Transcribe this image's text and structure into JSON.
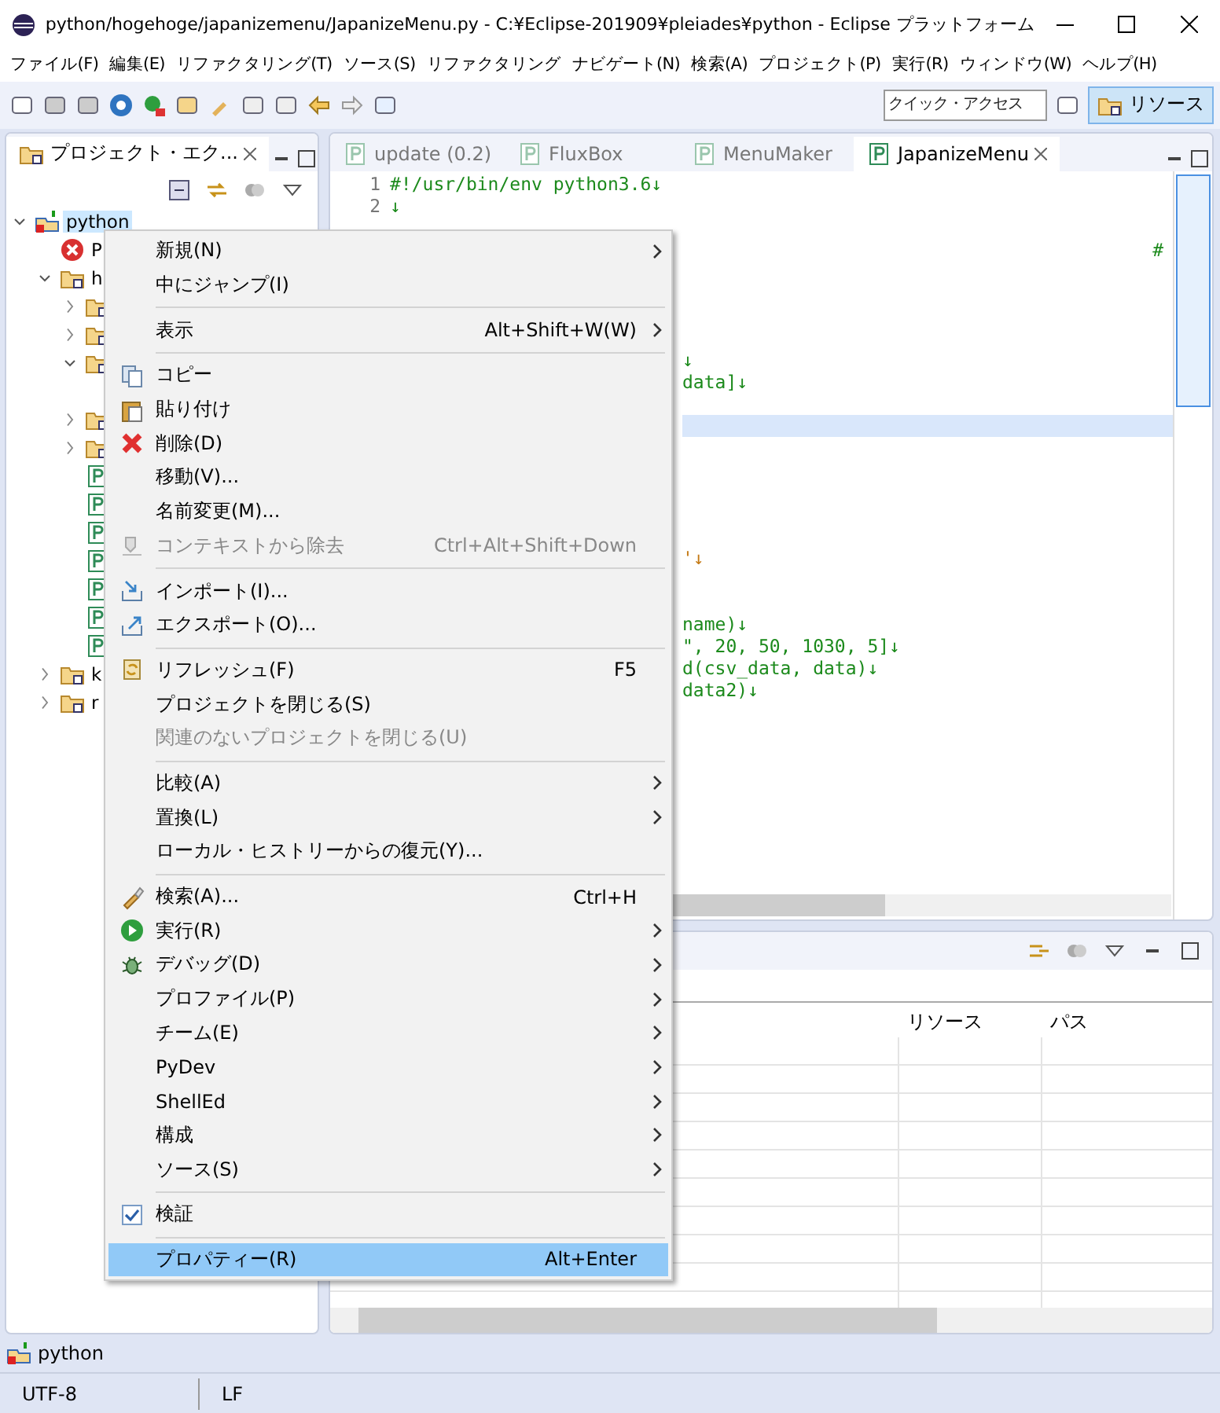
{
  "window": {
    "title": "python/hogehoge/japanizemenu/JapanizeMenu.py - C:¥Eclipse-201909¥pleiades¥python - Eclipse プラットフォーム"
  },
  "menubar": [
    "ファイル(F)",
    "編集(E)",
    "リファクタリング(T)",
    "ソース(S)",
    "リファクタリング",
    "ナビゲート(N)",
    "検索(A)",
    "プロジェクト(P)",
    "実行(R)",
    "ウィンドウ(W)",
    "ヘルプ(H)"
  ],
  "toolbar": {
    "quick_access": {
      "placeholder": "クイック・アクセス"
    },
    "perspectives": [
      {
        "label": "リソース",
        "selected": true
      }
    ]
  },
  "explorer": {
    "tab": "プロジェクト・エク...",
    "tree": [
      {
        "label": "python",
        "kind": "project",
        "selected": true,
        "expanded": true,
        "children": [
          {
            "label": "P",
            "kind": "error",
            "selected": false
          },
          {
            "label": "h",
            "kind": "folder",
            "selected": false,
            "expanded": true,
            "children": [
              {
                "kind": "folder",
                "selected": false,
                "expanded": false
              },
              {
                "kind": "folder",
                "selected": false,
                "expanded": false
              },
              {
                "kind": "folder",
                "selected": false,
                "expanded": true
              },
              {
                "kind": "folder",
                "selected": false,
                "expanded": false
              },
              {
                "kind": "folder",
                "selected": false,
                "expanded": false
              },
              {
                "kind": "file",
                "selected": false
              },
              {
                "kind": "file",
                "selected": false
              },
              {
                "kind": "file",
                "selected": false
              },
              {
                "kind": "file",
                "selected": false
              },
              {
                "kind": "file",
                "selected": false
              },
              {
                "kind": "file",
                "selected": false
              },
              {
                "kind": "file",
                "selected": false
              }
            ]
          },
          {
            "label": "k",
            "kind": "folder",
            "selected": false,
            "expanded": false
          },
          {
            "label": "r",
            "kind": "folder",
            "selected": false,
            "expanded": false
          }
        ]
      }
    ]
  },
  "editor": {
    "tabs": [
      {
        "label": "update (0.2)",
        "selected": false
      },
      {
        "label": "FluxBox",
        "selected": false
      },
      {
        "label": "MenuMaker",
        "selected": false
      },
      {
        "label": "JapanizeMenu",
        "selected": true
      }
    ],
    "lines": [
      {
        "number": "1",
        "text": "#!/usr/bin/env python3.6↓",
        "kind": "code",
        "current": false
      },
      {
        "number": "2",
        "text": "↓",
        "kind": "code",
        "current": false
      },
      {
        "current": false
      },
      {
        "text": "#",
        "kind": "margin",
        "current": false
      },
      {
        "current": false
      },
      {
        "current": false
      },
      {
        "current": false
      },
      {
        "current": false
      },
      {
        "text": "↓",
        "kind": "code",
        "current": false
      },
      {
        "text": "data]↓",
        "kind": "code",
        "current": false
      },
      {
        "current": false
      },
      {
        "current": true
      },
      {
        "current": false
      },
      {
        "current": false
      },
      {
        "current": false
      },
      {
        "current": false
      },
      {
        "current": false
      },
      {
        "text": "'↓",
        "kind": "string",
        "current": false
      },
      {
        "current": false
      },
      {
        "current": false
      },
      {
        "text": "name)↓",
        "kind": "code",
        "current": false
      },
      {
        "text": "\", 20, 50, 1030, 5]↓",
        "kind": "code",
        "current": false
      },
      {
        "text": "d(csv_data, data)↓",
        "kind": "code",
        "current": false
      },
      {
        "text": "data2)↓",
        "kind": "code",
        "current": false
      }
    ]
  },
  "problems": {
    "columns": [
      "リソース",
      "パス"
    ]
  },
  "context_menu": [
    {
      "kind": "item",
      "label": "新規(N)",
      "submenu": true,
      "disabled": false,
      "selected": false
    },
    {
      "kind": "item",
      "label": "中にジャンプ(I)",
      "submenu": false,
      "disabled": false,
      "selected": false
    },
    {
      "kind": "separator"
    },
    {
      "kind": "item",
      "label": "表示",
      "shortcut": "Alt+Shift+W(W)",
      "submenu": true,
      "disabled": false,
      "selected": false
    },
    {
      "kind": "separator"
    },
    {
      "kind": "item",
      "label": "コピー",
      "submenu": false,
      "disabled": false,
      "selected": false
    },
    {
      "kind": "item",
      "label": "貼り付け",
      "submenu": false,
      "disabled": false,
      "selected": false
    },
    {
      "kind": "item",
      "label": "削除(D)",
      "submenu": false,
      "disabled": false,
      "selected": false
    },
    {
      "kind": "item",
      "label": "移動(V)...",
      "submenu": false,
      "disabled": false,
      "selected": false
    },
    {
      "kind": "item",
      "label": "名前変更(M)...",
      "submenu": false,
      "disabled": false,
      "selected": false
    },
    {
      "kind": "item",
      "label": "コンテキストから除去",
      "shortcut": "Ctrl+Alt+Shift+Down",
      "submenu": false,
      "disabled": true,
      "selected": false
    },
    {
      "kind": "separator"
    },
    {
      "kind": "item",
      "label": "インポート(I)...",
      "submenu": false,
      "disabled": false,
      "selected": false
    },
    {
      "kind": "item",
      "label": "エクスポート(O)...",
      "submenu": false,
      "disabled": false,
      "selected": false
    },
    {
      "kind": "separator"
    },
    {
      "kind": "item",
      "label": "リフレッシュ(F)",
      "shortcut": "F5",
      "submenu": false,
      "disabled": false,
      "selected": false
    },
    {
      "kind": "item",
      "label": "プロジェクトを閉じる(S)",
      "submenu": false,
      "disabled": false,
      "selected": false
    },
    {
      "kind": "item",
      "label": "関連のないプロジェクトを閉じる(U)",
      "submenu": false,
      "disabled": true,
      "selected": false
    },
    {
      "kind": "separator"
    },
    {
      "kind": "item",
      "label": "比較(A)",
      "submenu": true,
      "disabled": false,
      "selected": false
    },
    {
      "kind": "item",
      "label": "置換(L)",
      "submenu": true,
      "disabled": false,
      "selected": false
    },
    {
      "kind": "item",
      "label": "ローカル・ヒストリーからの復元(Y)...",
      "submenu": false,
      "disabled": false,
      "selected": false
    },
    {
      "kind": "separator"
    },
    {
      "kind": "item",
      "label": "検索(A)...",
      "shortcut": "Ctrl+H",
      "submenu": false,
      "disabled": false,
      "selected": false
    },
    {
      "kind": "item",
      "label": "実行(R)",
      "submenu": true,
      "disabled": false,
      "selected": false
    },
    {
      "kind": "item",
      "label": "デバッグ(D)",
      "submenu": true,
      "disabled": false,
      "selected": false
    },
    {
      "kind": "item",
      "label": "プロファイル(P)",
      "submenu": true,
      "disabled": false,
      "selected": false
    },
    {
      "kind": "item",
      "label": "チーム(E)",
      "submenu": true,
      "disabled": false,
      "selected": false
    },
    {
      "kind": "item",
      "label": "PyDev",
      "submenu": true,
      "disabled": false,
      "selected": false
    },
    {
      "kind": "item",
      "label": "ShellEd",
      "submenu": true,
      "disabled": false,
      "selected": false
    },
    {
      "kind": "item",
      "label": "構成",
      "submenu": true,
      "disabled": false,
      "selected": false
    },
    {
      "kind": "item",
      "label": "ソース(S)",
      "submenu": true,
      "disabled": false,
      "selected": false
    },
    {
      "kind": "separator"
    },
    {
      "kind": "check",
      "label": "検証",
      "checked": true,
      "submenu": false,
      "disabled": false,
      "selected": false
    },
    {
      "kind": "separator"
    },
    {
      "kind": "item",
      "label": "プロパティー(R)",
      "shortcut": "Alt+Enter",
      "submenu": false,
      "disabled": false,
      "selected": true
    }
  ],
  "status": {
    "selection": "python",
    "encoding": "UTF-8",
    "line_delimiter": "LF"
  }
}
